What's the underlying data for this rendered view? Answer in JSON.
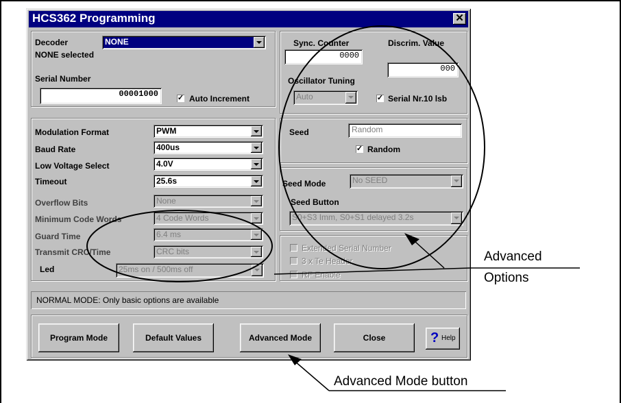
{
  "window": {
    "title": "HCS362 Programming",
    "close_glyph": "✕"
  },
  "decoder": {
    "label": "Decoder",
    "value": "NONE",
    "status": "NONE selected"
  },
  "serial": {
    "label": "Serial Number",
    "value": "00001000",
    "auto_increment_label": "Auto Increment",
    "auto_increment_checked": true
  },
  "sync": {
    "label": "Sync. Counter",
    "value": "0000"
  },
  "discrim": {
    "label": "Discrim. Value",
    "value": "000"
  },
  "oscillator": {
    "label": "Oscillator Tuning",
    "value": "Auto"
  },
  "serial_lsb": {
    "label": "Serial Nr.10 lsb",
    "checked": true
  },
  "params": [
    {
      "label": "Modulation Format",
      "value": "PWM",
      "enabled": true
    },
    {
      "label": "Baud Rate",
      "value": "400us",
      "enabled": true
    },
    {
      "label": "Low Voltage Select",
      "value": "4.0V",
      "enabled": true
    },
    {
      "label": "Timeout",
      "value": "25.6s",
      "enabled": true
    },
    {
      "label": "Overflow Bits",
      "value": "None",
      "enabled": false
    },
    {
      "label": "Minimum Code Words",
      "value": "4 Code Words",
      "enabled": false
    },
    {
      "label": "Guard Time",
      "value": "6.4 ms",
      "enabled": false
    },
    {
      "label": "Transmit CRC/Time",
      "value": "CRC bits",
      "enabled": false
    }
  ],
  "led": {
    "label": "Led",
    "value": "25ms on / 500ms off"
  },
  "seed": {
    "label": "Seed",
    "value": "Random",
    "random_label": "Random",
    "random_checked": true
  },
  "seed_mode": {
    "label": "Seed Mode",
    "value": "No SEED"
  },
  "seed_button": {
    "label": "Seed Button",
    "value": "S0+S3 Imm, S0+S1 delayed 3.2s"
  },
  "advanced_checks": [
    {
      "label": "Extended Serial Number"
    },
    {
      "label": "3 x Te Header"
    },
    {
      "label": "RF Enable"
    }
  ],
  "status_text": "NORMAL MODE: Only basic options are available",
  "buttons": {
    "program_mode": "Program Mode",
    "default_values": "Default Values",
    "advanced_mode": "Advanced Mode",
    "close": "Close",
    "help": "Help"
  },
  "callouts": {
    "advanced_options_line1": "Advanced",
    "advanced_options_line2": "Options",
    "advanced_mode_button": "Advanced Mode button"
  }
}
